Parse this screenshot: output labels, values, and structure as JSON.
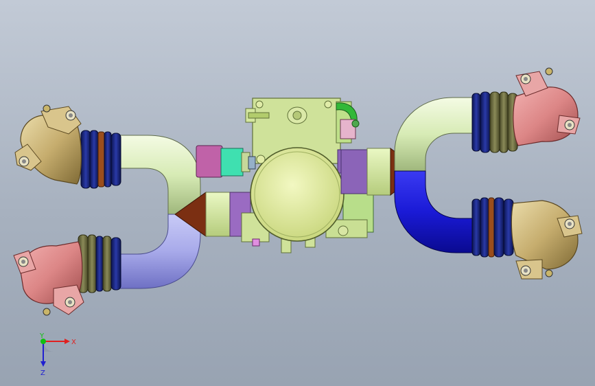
{
  "viewport": {
    "background_top": "#c2cad6",
    "background_bottom": "#98a3b2"
  },
  "model": {
    "description_icon": "cad-exhaust-manifold-model",
    "colors": {
      "pale_green": "#dff2bf",
      "bright_green": "#cfe08f",
      "blue": "#1c1ce0",
      "lavender": "#aeb0ea",
      "salmon": "#df9090",
      "tan": "#c9b277",
      "brown": "#7a2d12",
      "dark_navy": "#101a6a",
      "rust_band": "#a0551e",
      "olive_band": "#6a6a3a",
      "magenta": "#c462b4",
      "teal": "#3fd8b4",
      "yellow_green": "#d6e58a"
    }
  },
  "triad": {
    "x_label": "X",
    "y_label": "Y",
    "z_label": "Z",
    "x_color": "#e02020",
    "y_color": "#10c010",
    "z_color": "#2020d0"
  }
}
